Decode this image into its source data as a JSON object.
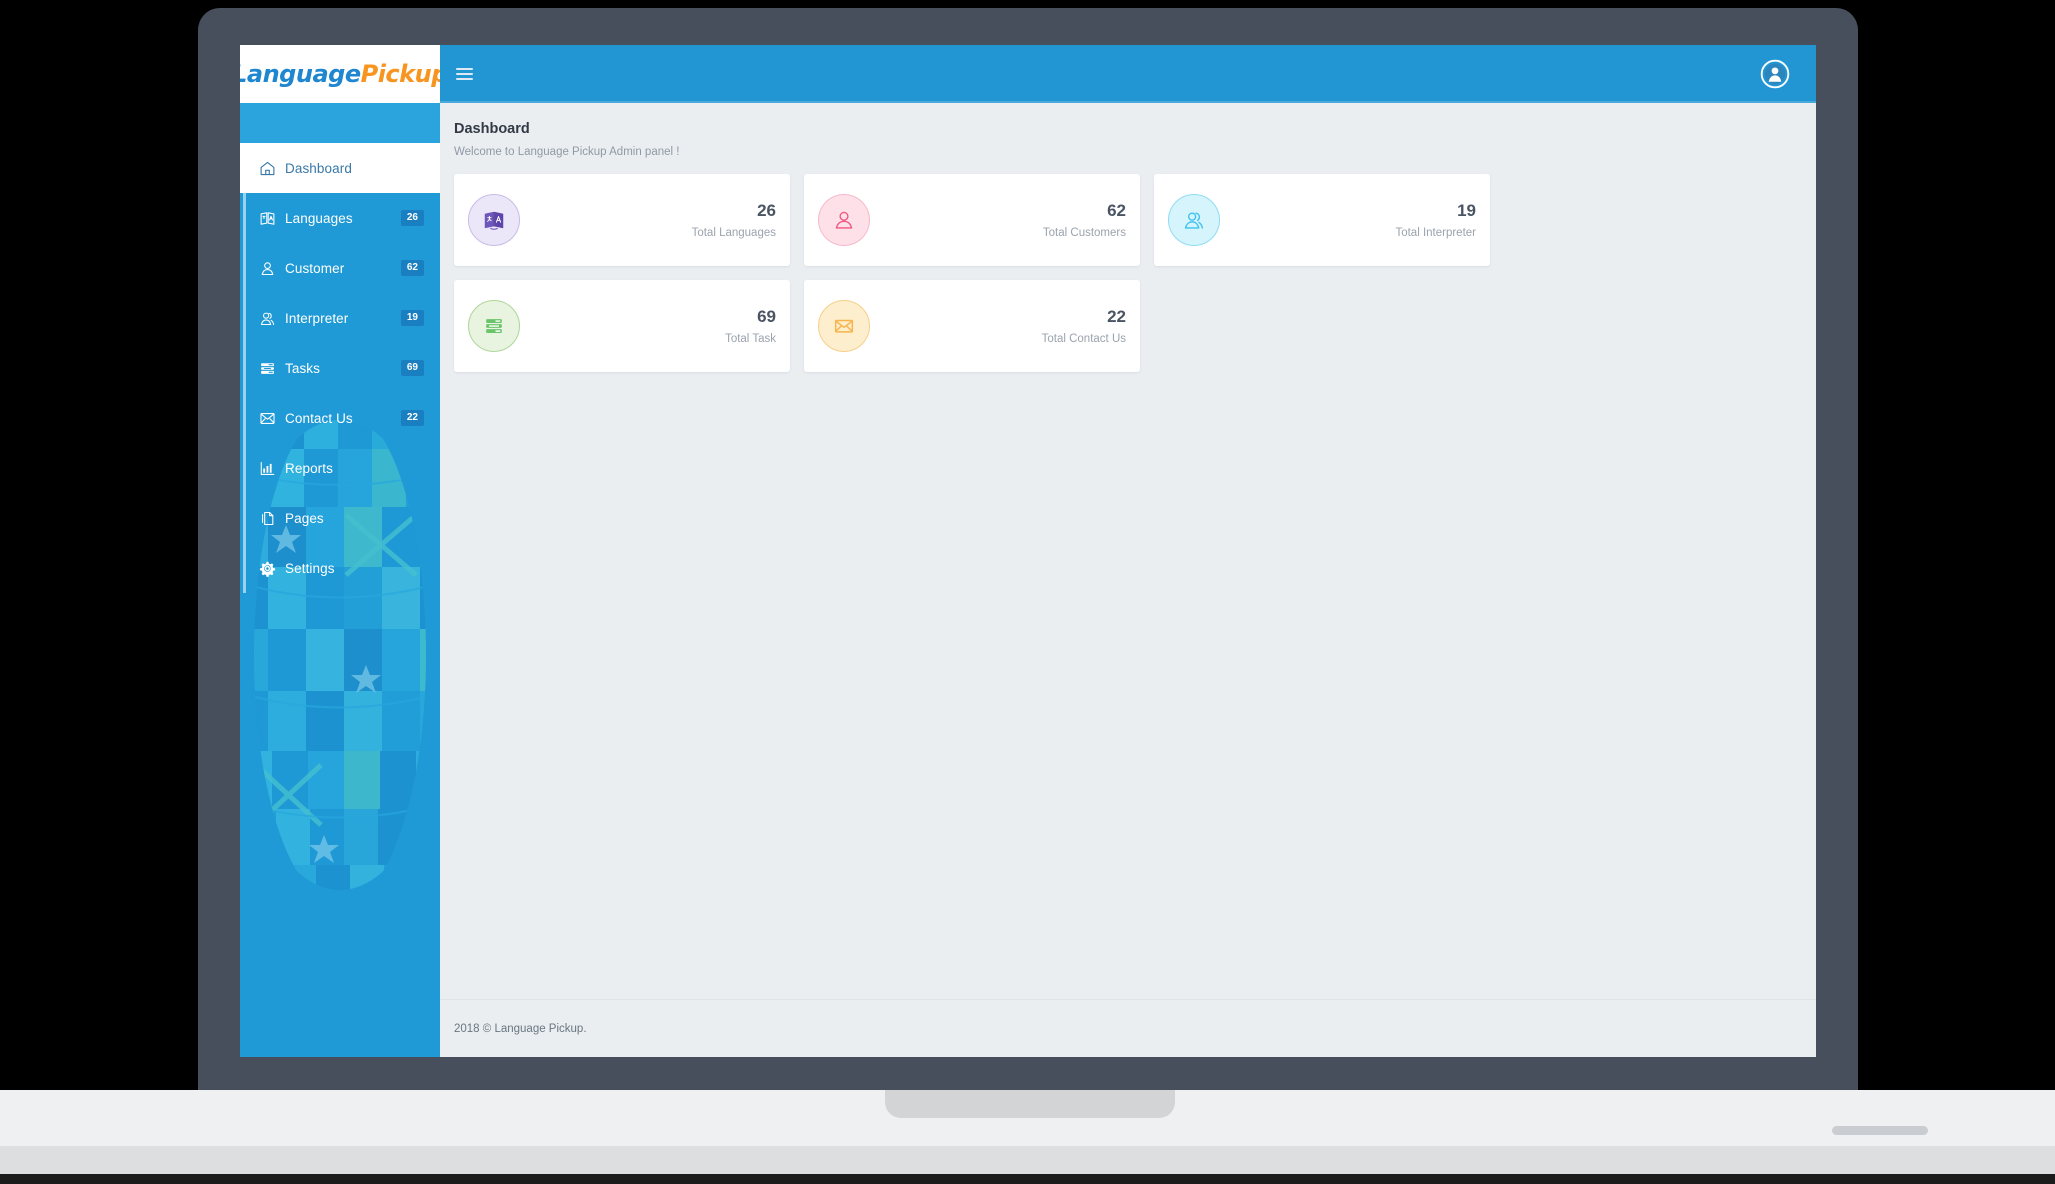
{
  "brand": {
    "logo_part1": "Language",
    "logo_part2": "Pickup",
    "logo_color_1": "#1f86d0",
    "logo_color_2": "#f79520"
  },
  "topbar": {
    "menu_toggle_label": "☰",
    "user_menu_label": "User account"
  },
  "sidebar": {
    "items": [
      {
        "label": "Dashboard",
        "badge": "",
        "icon": "home-icon",
        "active": true
      },
      {
        "label": "Languages",
        "badge": "26",
        "icon": "translate-icon",
        "active": false
      },
      {
        "label": "Customer",
        "badge": "62",
        "icon": "user-icon",
        "active": false
      },
      {
        "label": "Interpreter",
        "badge": "19",
        "icon": "interpreter-icon",
        "active": false
      },
      {
        "label": "Tasks",
        "badge": "69",
        "icon": "tasks-icon",
        "active": false
      },
      {
        "label": "Contact Us",
        "badge": "22",
        "icon": "envelope-icon",
        "active": false
      },
      {
        "label": "Reports",
        "badge": "",
        "icon": "chart-bar-icon",
        "active": false
      },
      {
        "label": "Pages",
        "badge": "",
        "icon": "pages-icon",
        "active": false
      },
      {
        "label": "Settings",
        "badge": "",
        "icon": "gear-icon",
        "active": false
      }
    ],
    "background": "#1f9ad6",
    "badge_color": "#1a7fc0"
  },
  "page": {
    "title": "Dashboard",
    "subtitle": "Welcome to Language Pickup Admin panel !"
  },
  "cards": [
    {
      "value": "26",
      "label": "Total Languages",
      "icon": "translate-icon",
      "accent": "#7a61c4",
      "bg": "#ece7f8"
    },
    {
      "value": "62",
      "label": "Total Customers",
      "icon": "user-icon",
      "accent": "#f2577f",
      "bg": "#fde0e8"
    },
    {
      "value": "19",
      "label": "Total Interpreter",
      "icon": "interpreter-icon",
      "accent": "#3fc1ee",
      "bg": "#d5f4fc"
    },
    {
      "value": "69",
      "label": "Total Task",
      "icon": "tasks-icon",
      "accent": "#6bc46b",
      "bg": "#e3f3dc"
    },
    {
      "value": "22",
      "label": "Total Contact Us",
      "icon": "envelope-icon",
      "accent": "#f8b44c",
      "bg": "#fdeecd"
    }
  ],
  "footer": {
    "copyright": "2018 © Language Pickup."
  }
}
